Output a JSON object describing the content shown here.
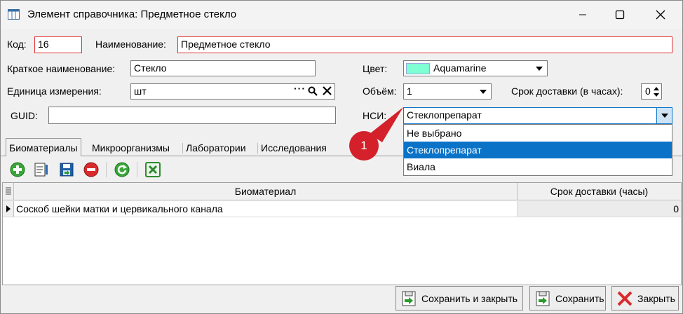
{
  "window": {
    "title": "Элемент справочника: Предметное стекло"
  },
  "form": {
    "code_label": "Код:",
    "code_value": "16",
    "name_label": "Наименование:",
    "name_value": "Предметное стекло",
    "short_name_label": "Краткое наименование:",
    "short_name_value": "Стекло",
    "unit_label": "Единица измерения:",
    "unit_value": "шт",
    "guid_label": "GUID:",
    "guid_value": "",
    "color_label": "Цвет:",
    "color_value": "Aquamarine",
    "color_swatch": "#7fffd4",
    "volume_label": "Объём:",
    "volume_value": "1",
    "delivery_label": "Срок доставки (в часах):",
    "delivery_value": "0",
    "nsi_label": "НСИ:",
    "nsi_value": "Стеклопрепарат",
    "nsi_options": [
      "Не выбрано",
      "Стеклопрепарат",
      "Виала"
    ],
    "nsi_selected_index": 1
  },
  "tabs": [
    "Биоматериалы",
    "Микроорганизмы",
    "Лаборатории",
    "Исследования"
  ],
  "toolbar": {
    "icons": [
      "add-icon",
      "edit-icon",
      "save-icon",
      "delete-icon",
      "refresh-icon",
      "excel-icon"
    ]
  },
  "grid": {
    "columns": [
      "Биоматериал",
      "Срок доставки (часы)"
    ],
    "rows": [
      {
        "biomaterial": "Соскоб шейки матки и цервикального канала",
        "delivery": "0"
      }
    ]
  },
  "buttons": {
    "save_close": "Сохранить и закрыть",
    "save": "Сохранить",
    "close": "Закрыть"
  },
  "callout": {
    "number": "1",
    "color": "#d3202a"
  },
  "colors": {
    "selection": "#0a73c8",
    "required_border": "#e03030"
  }
}
